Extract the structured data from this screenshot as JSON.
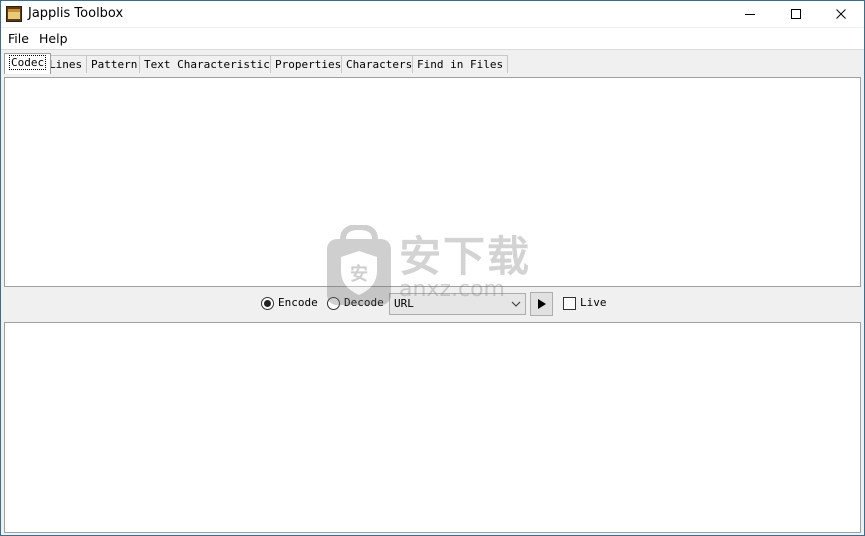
{
  "window": {
    "title": "Japplis Toolbox",
    "icon": "toolbox-icon",
    "controls": [
      "minimize-icon",
      "maximize-icon",
      "close-icon"
    ]
  },
  "menu": {
    "items": [
      {
        "label": "File"
      },
      {
        "label": "Help"
      }
    ]
  },
  "tabs": [
    {
      "label": "Codec",
      "active": true
    },
    {
      "label": "Lines"
    },
    {
      "label": "Pattern"
    },
    {
      "label": "Text Characteristics"
    },
    {
      "label": "Properties"
    },
    {
      "label": "Characters"
    },
    {
      "label": "Find in Files"
    }
  ],
  "codec": {
    "input_text": "",
    "output_text": "",
    "encode_label": "Encode",
    "decode_label": "Decode",
    "mode_selected": "Encode",
    "format_selected": "URL",
    "run_icon": "play-icon",
    "live_label": "Live",
    "live_checked": false
  },
  "watermark": {
    "title": "安下载",
    "sub": "anxz.com"
  },
  "colors": {
    "window_border": "#3c6e8c",
    "background": "#f0f0f0",
    "pane": "#ffffff"
  }
}
